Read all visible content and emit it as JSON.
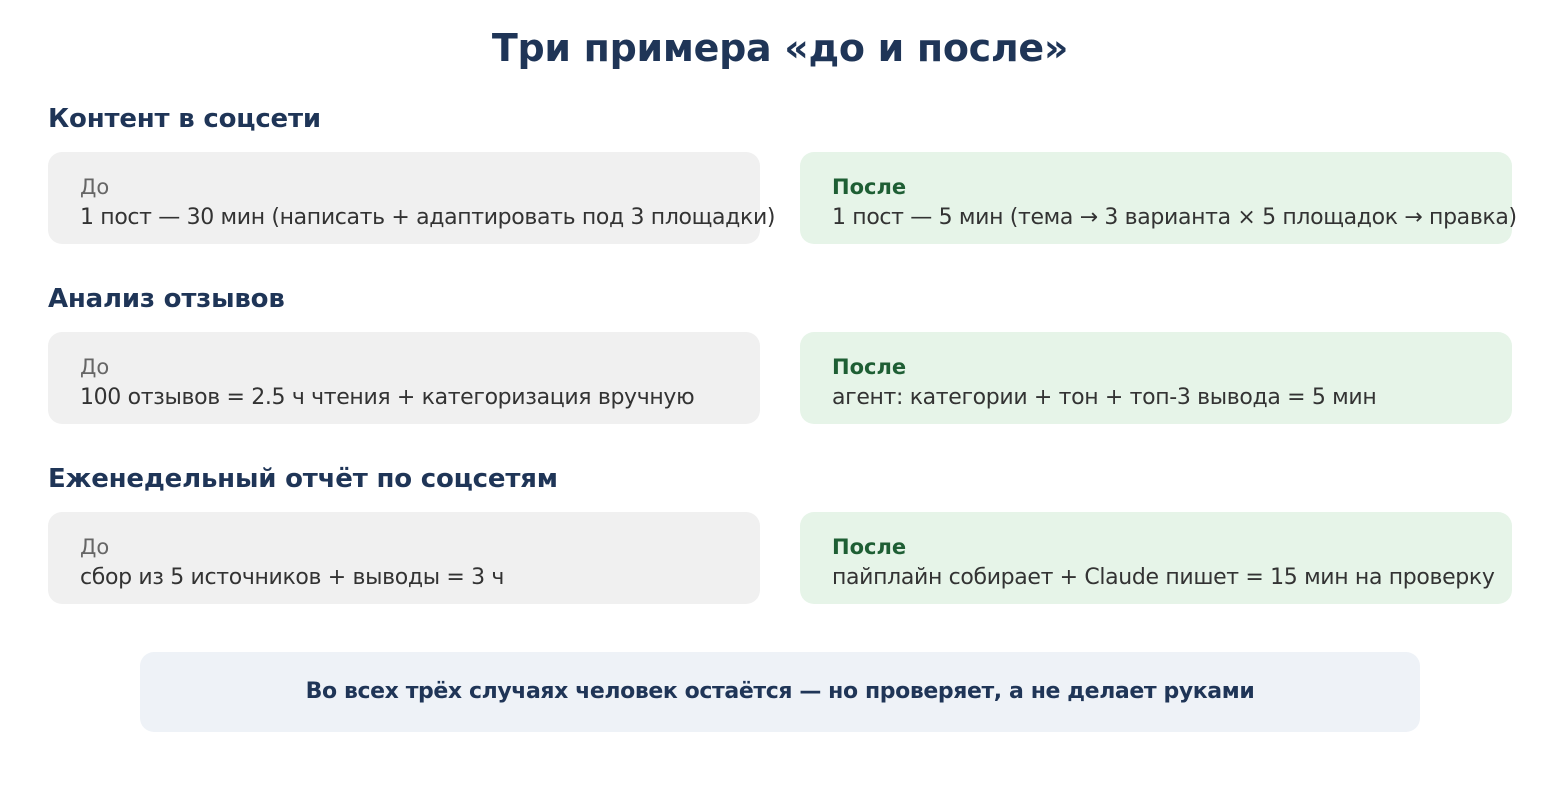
{
  "title": "Три примера «до и после»",
  "colors": {
    "heading": "#1f3557",
    "before_bg": "#f0f0f0",
    "after_bg": "#e6f4e8",
    "after_label": "#1e5e34",
    "conclusion_bg": "#eef2f7"
  },
  "sections": [
    {
      "heading": "Контент в соцсети",
      "before_label": "До",
      "before_text": "1 пост — 30 мин (написать + адаптировать под 3 площадки)",
      "after_label": "После",
      "after_text": "1 пост — 5 мин (тема → 3 варианта × 5 площадок → правка)"
    },
    {
      "heading": "Анализ отзывов",
      "before_label": "До",
      "before_text": "100 отзывов = 2.5 ч чтения + категоризация вручную",
      "after_label": "После",
      "after_text": "агент: категории + тон + топ-3 вывода = 5 мин"
    },
    {
      "heading": "Еженедельный отчёт по соцсетям",
      "before_label": "До",
      "before_text": "сбор из 5 источников + выводы = 3 ч",
      "after_label": "После",
      "after_text": "пайплайн собирает + Claude пишет = 15 мин на проверку"
    }
  ],
  "conclusion": "Во всех трёх случаях человек остаётся — но проверяет, а не делает руками"
}
